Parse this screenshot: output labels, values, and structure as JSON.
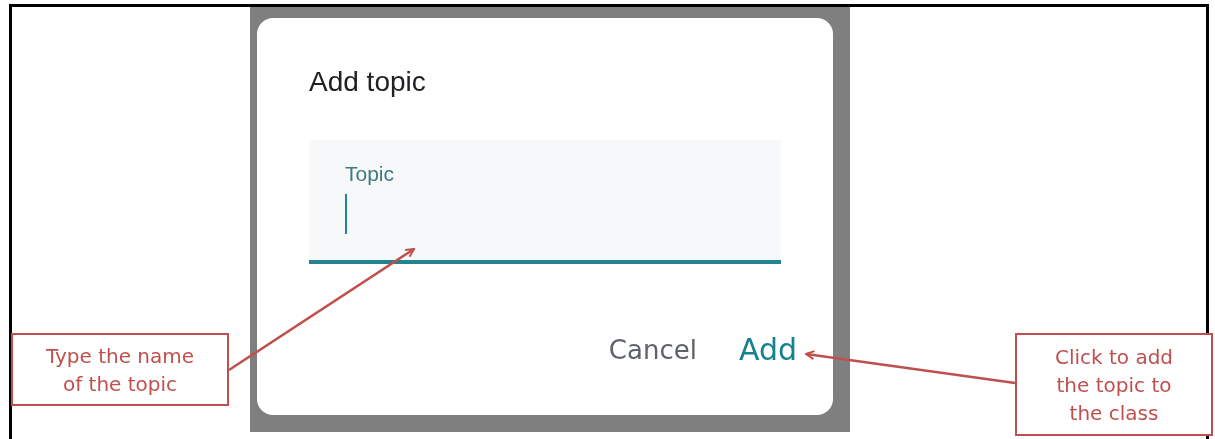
{
  "dialog": {
    "title": "Add topic",
    "field": {
      "label": "Topic",
      "focused": true
    },
    "buttons": [
      {
        "label": "Cancel",
        "kind": "text"
      },
      {
        "label": "Add",
        "kind": "primary"
      }
    ]
  },
  "annotations": [
    {
      "text": "Type the name\nof the topic",
      "kind": "left"
    },
    {
      "text": "Click to add\nthe topic to\nthe class",
      "kind": "right"
    }
  ]
}
